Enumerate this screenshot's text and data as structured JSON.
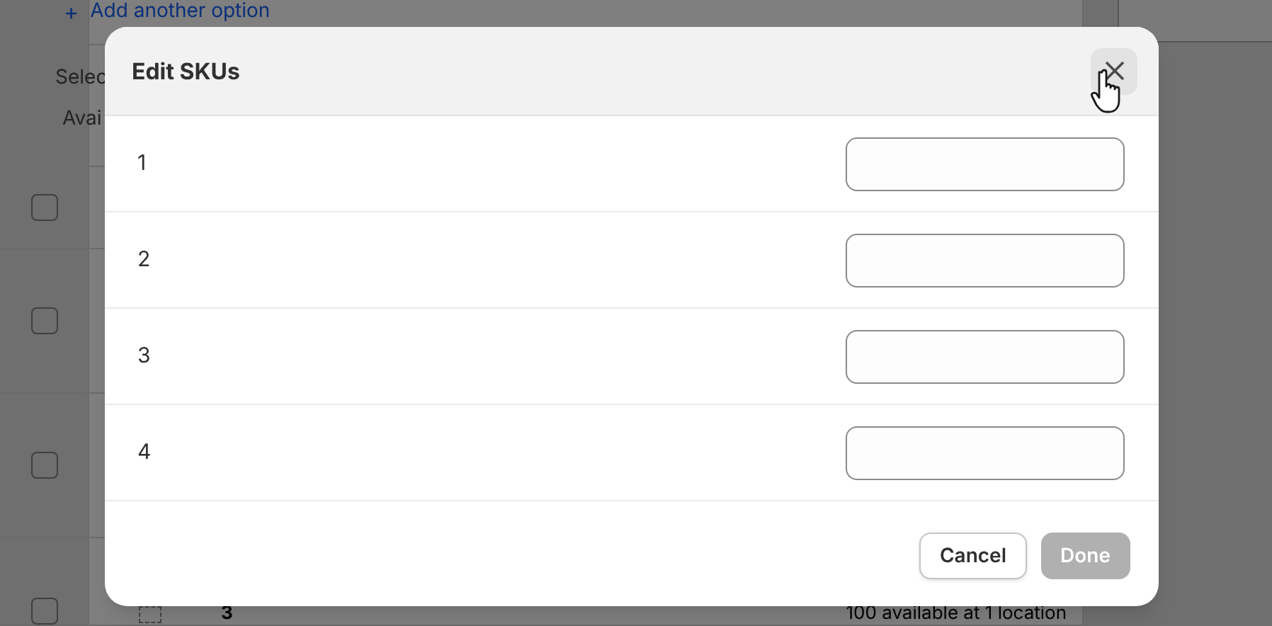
{
  "background": {
    "add_option_icon": "+",
    "add_option_link": "Add another option",
    "select_label": "Selec",
    "available_label": "Avai",
    "rows": [
      {
        "checked": false
      },
      {
        "checked": false
      },
      {
        "checked": false
      },
      {
        "checked": false,
        "name": "3",
        "availability": "100 available at 1 location"
      }
    ]
  },
  "dialog": {
    "title": "Edit SKUs",
    "rows": [
      {
        "label": "1"
      },
      {
        "label": "2"
      },
      {
        "label": "3"
      },
      {
        "label": "4"
      }
    ],
    "buttons": [
      {
        "label": "Cancel",
        "disabled": false,
        "kind": "secondary"
      },
      {
        "label": "Done",
        "disabled": true,
        "kind": "primary"
      }
    ]
  }
}
